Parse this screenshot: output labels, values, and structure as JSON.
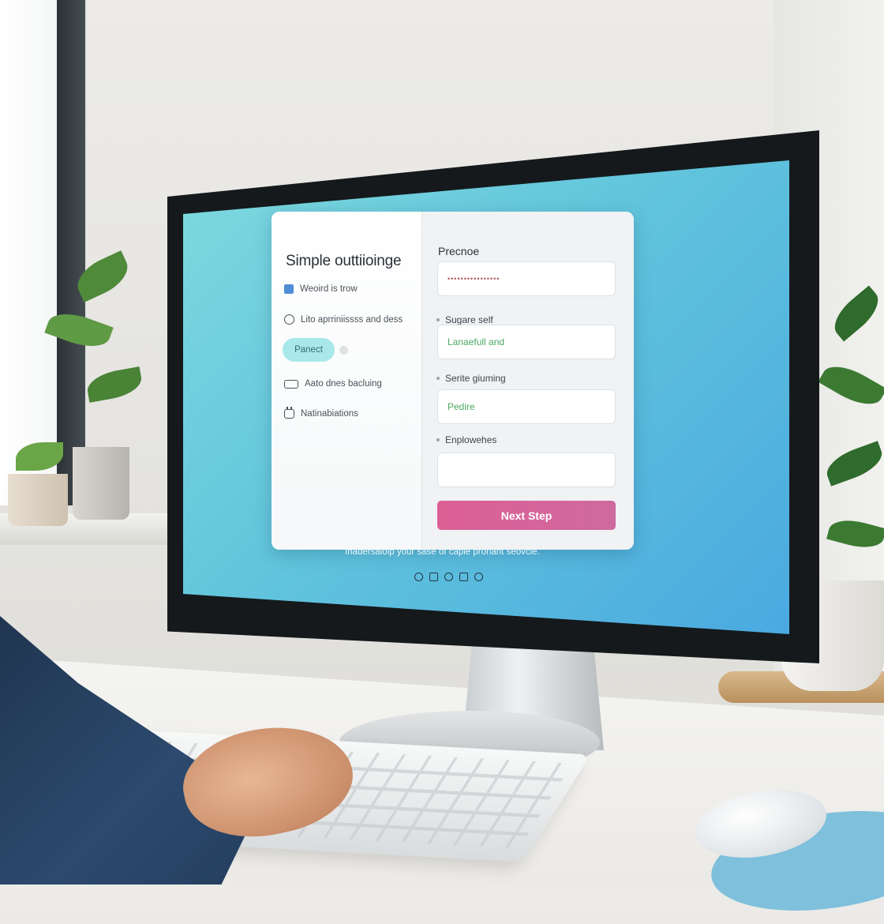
{
  "sidebar": {
    "title": "Simple outtiioinge",
    "items": [
      {
        "label": "Weoird is trow",
        "icon": "calendar-icon"
      },
      {
        "label": "Lito aprriniissss and dess",
        "icon": "circle-icon"
      },
      {
        "label": "Aato dnes bacluing",
        "icon": "rectangle-icon"
      },
      {
        "label": "Natinabiations",
        "icon": "calendar-icon"
      }
    ],
    "pill_label": "Panect"
  },
  "form": {
    "title": "Precnoe",
    "fields": [
      {
        "label": "",
        "value": "••••••••••••••••"
      },
      {
        "label": "Sugare self",
        "value": "Lanaefull and"
      },
      {
        "label": "Serite giuming",
        "value": "Pedire"
      },
      {
        "label": "Enplowehes",
        "value": ""
      }
    ],
    "button_label": "Next Step"
  },
  "footer": {
    "caption": "Ihadersaioip your sase of caple proriant seovcle.",
    "icons": [
      "globe-icon",
      "lock-icon",
      "shield-icon",
      "chat-icon",
      "info-icon"
    ]
  },
  "colors": {
    "accent_button": "#dc5f96",
    "pill": "#a9e8ea",
    "screen_gradient_start": "#7fdadf",
    "screen_gradient_end": "#4aa9e0",
    "field_text": "#4da865"
  }
}
